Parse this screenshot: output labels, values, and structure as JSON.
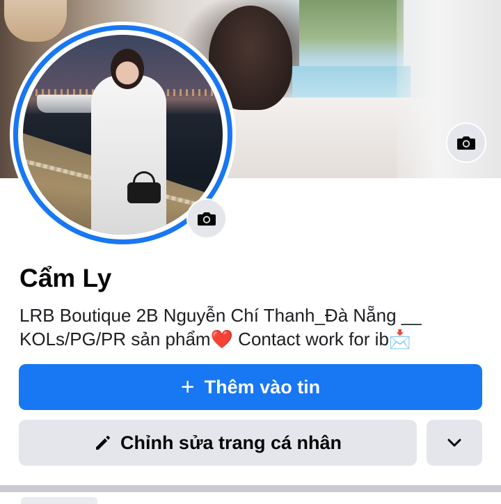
{
  "colors": {
    "accent": "#1877f2",
    "secondary_button": "#e4e6eb",
    "text": "#050505"
  },
  "profile": {
    "name": "Cẩm Ly",
    "bio_line1": "LRB Boutique  2B Nguyễn Chí Thanh_Đà Nẵng __",
    "bio_line2_text": "KOLs/PG/PR sản phẩm",
    "bio_heart": "❤️",
    "bio_line2_tail": " Contact work for ib",
    "bio_envelope": "📩"
  },
  "actions": {
    "add_story_label": "Thêm vào tin",
    "add_story_icon": "+",
    "edit_profile_label": "Chỉnh sửa trang cá nhân",
    "edit_profile_icon": "pencil-icon",
    "more_icon": "chevron-down-icon"
  },
  "icons": {
    "cover_camera": "camera-icon",
    "avatar_camera": "camera-icon"
  }
}
